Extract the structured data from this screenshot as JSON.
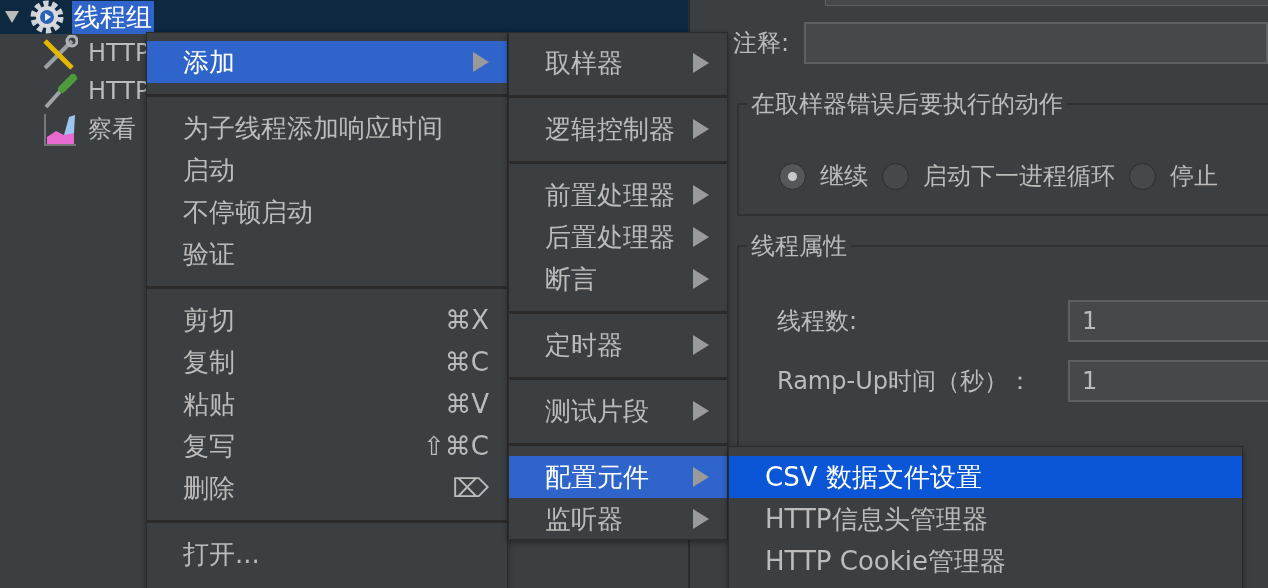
{
  "tree": {
    "root": {
      "label": "线程组",
      "selected": true,
      "expanded": true,
      "children": [
        {
          "label": "HTTP",
          "kind": "wrench"
        },
        {
          "label": "HTTP",
          "kind": "pipette"
        },
        {
          "label": "察看",
          "kind": "graph"
        }
      ]
    }
  },
  "form": {
    "comment_label": "注释:",
    "on_error": {
      "title": "在取样器错误后要执行的动作",
      "options": [
        {
          "label": "继续",
          "selected": true
        },
        {
          "label": "启动下一进程循环",
          "selected": false
        },
        {
          "label": "停止",
          "selected": false
        }
      ]
    },
    "thread_properties": {
      "title": "线程属性",
      "fields": [
        {
          "label": "线程数:",
          "value": "1"
        },
        {
          "label": "Ramp-Up时间（秒）：",
          "value": "1"
        }
      ]
    }
  },
  "context_menu": {
    "groups": [
      [
        {
          "label": "添加",
          "selected": true,
          "submenu": true
        }
      ],
      [
        {
          "label": "为子线程添加响应时间",
          "selected": false,
          "submenu": false
        },
        {
          "label": "启动",
          "selected": false,
          "submenu": false
        },
        {
          "label": "不停顿启动",
          "selected": false,
          "submenu": false
        },
        {
          "label": "验证",
          "selected": false,
          "submenu": false
        }
      ],
      [
        {
          "label": "剪切",
          "selected": false,
          "submenu": false,
          "shortcut": "⌘X"
        },
        {
          "label": "复制",
          "selected": false,
          "submenu": false,
          "shortcut": "⌘C"
        },
        {
          "label": "粘贴",
          "selected": false,
          "submenu": false,
          "shortcut": "⌘V"
        },
        {
          "label": "复写",
          "selected": false,
          "submenu": false,
          "shortcut": "⇧⌘C"
        },
        {
          "label": "删除",
          "selected": false,
          "submenu": false,
          "shortcut": "⌦"
        }
      ],
      [
        {
          "label": "打开...",
          "selected": false,
          "submenu": false
        }
      ]
    ]
  },
  "add_submenu": {
    "groups": [
      [
        {
          "label": "取样器",
          "selected": false,
          "submenu": true
        }
      ],
      [
        {
          "label": "逻辑控制器",
          "selected": false,
          "submenu": true
        }
      ],
      [
        {
          "label": "前置处理器",
          "selected": false,
          "submenu": true
        },
        {
          "label": "后置处理器",
          "selected": false,
          "submenu": true
        },
        {
          "label": "断言",
          "selected": false,
          "submenu": true
        }
      ],
      [
        {
          "label": "定时器",
          "selected": false,
          "submenu": true
        }
      ],
      [
        {
          "label": "测试片段",
          "selected": false,
          "submenu": true
        }
      ],
      [
        {
          "label": "配置元件",
          "selected": true,
          "submenu": true
        },
        {
          "label": "监听器",
          "selected": false,
          "submenu": true
        }
      ]
    ]
  },
  "config_submenu": {
    "groups": [
      [
        {
          "label": "CSV 数据文件设置",
          "selected": true,
          "submenu": false
        },
        {
          "label": "HTTP信息头管理器",
          "selected": false,
          "submenu": false
        },
        {
          "label": "HTTP Cookie管理器",
          "selected": false,
          "submenu": false
        }
      ]
    ]
  }
}
